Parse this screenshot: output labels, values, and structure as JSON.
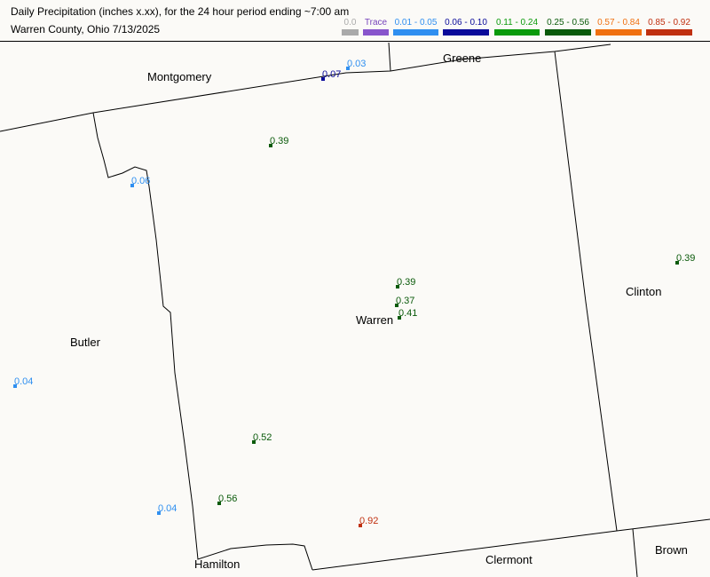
{
  "header": {
    "title": "Daily Precipitation (inches  x.xx),  for the 24 hour period ending ~7:00 am",
    "subtitle": "Warren County, Ohio  7/13/2025"
  },
  "legend": [
    {
      "label": "0.0",
      "color": "#aaaaaa",
      "text_color": "#aaaaaa"
    },
    {
      "label": "Trace",
      "color": "#8855cc",
      "text_color": "#7744bb"
    },
    {
      "label": "0.01 - 0.05",
      "color": "#2f8ff0",
      "text_color": "#2f8ff0"
    },
    {
      "label": "0.06 - 0.10",
      "color": "#0a0a9a",
      "text_color": "#0a0a9a"
    },
    {
      "label": "0.11 - 0.24",
      "color": "#0a9a0a",
      "text_color": "#0a9a0a"
    },
    {
      "label": "0.25 - 0.56",
      "color": "#0a5a0a",
      "text_color": "#0a5a0a"
    },
    {
      "label": "0.57 - 0.84",
      "color": "#f07010",
      "text_color": "#f07010"
    },
    {
      "label": "0.85 - 0.92",
      "color": "#c03010",
      "text_color": "#c03010"
    }
  ],
  "counties": {
    "montgomery": "Montgomery",
    "greene": "Greene",
    "butler": "Butler",
    "warren": "Warren",
    "clinton": "Clinton",
    "hamilton": "Hamilton",
    "clermont": "Clermont",
    "brown": "Brown"
  },
  "stations": [
    {
      "value": "0.03",
      "color": "#2f8ff0"
    },
    {
      "value": "0.07",
      "color": "#0a0a9a"
    },
    {
      "value": "0.39",
      "color": "#0a5a0a"
    },
    {
      "value": "0.06",
      "color": "#2f8ff0"
    },
    {
      "value": "0.39",
      "color": "#0a5a0a"
    },
    {
      "value": "0.39",
      "color": "#0a5a0a"
    },
    {
      "value": "0.37",
      "color": "#0a5a0a"
    },
    {
      "value": "0.41",
      "color": "#0a5a0a"
    },
    {
      "value": "0.04",
      "color": "#2f8ff0"
    },
    {
      "value": "0.52",
      "color": "#0a5a0a"
    },
    {
      "value": "0.56",
      "color": "#0a5a0a"
    },
    {
      "value": "0.04",
      "color": "#2f8ff0"
    },
    {
      "value": "0.92",
      "color": "#c03010"
    }
  ]
}
